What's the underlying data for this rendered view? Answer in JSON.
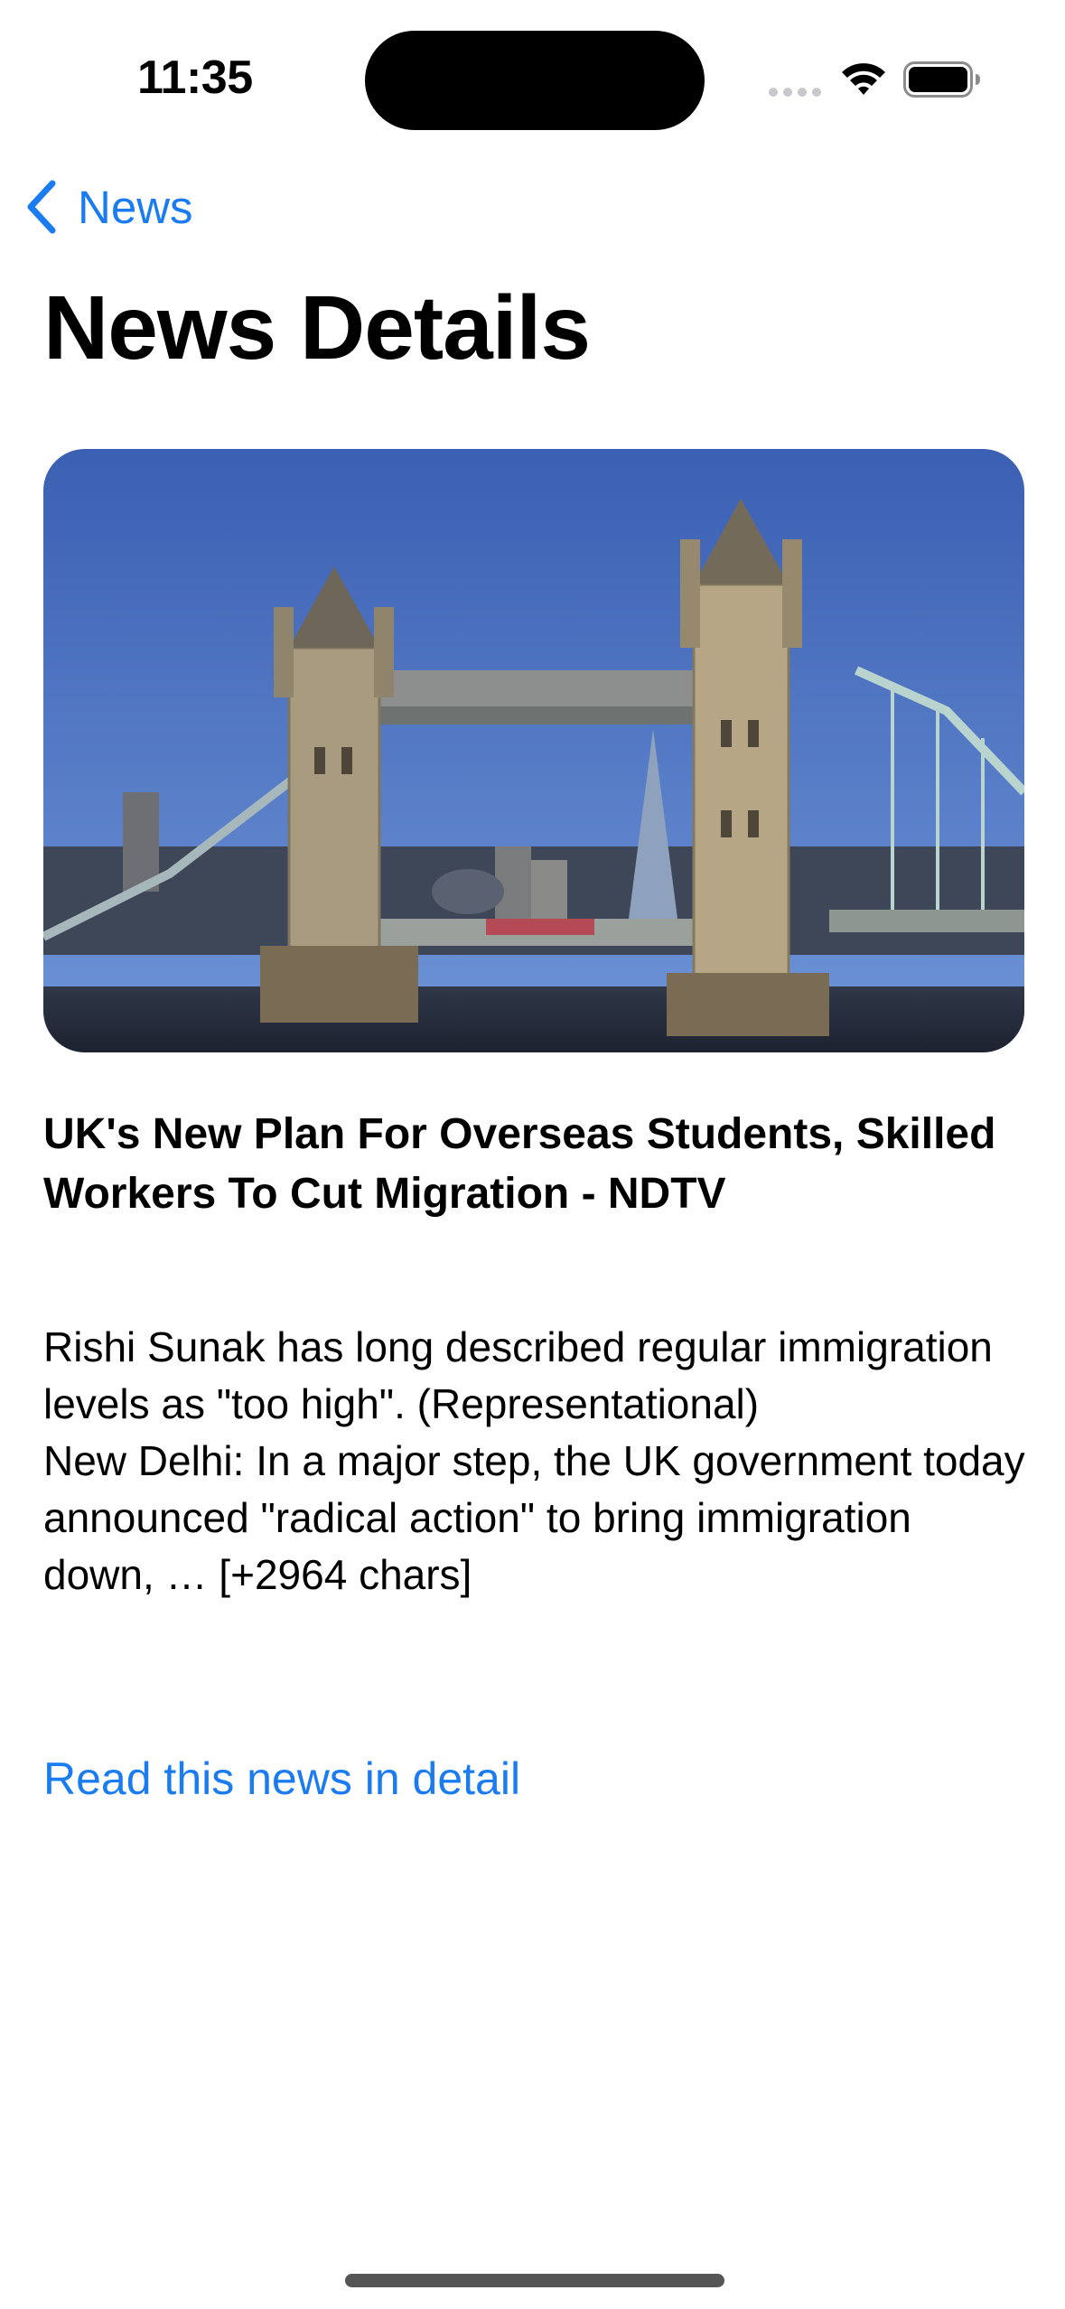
{
  "status_bar": {
    "time": "11:35"
  },
  "nav": {
    "back_label": "News",
    "title": "News Details"
  },
  "article": {
    "image_icon": "tower-bridge-photo",
    "headline": "UK's New Plan For Overseas Students, Skilled Workers To Cut Migration - NDTV",
    "description": "Rishi Sunak has long described regular immigration levels as \"too high\". (Representational)\nNew Delhi: In a major step, the UK government today announced \"radical action\" to bring immigration down, … [+2964 chars]",
    "read_more_label": "Read this news in detail"
  },
  "colors": {
    "accent": "#1a7cf0",
    "text": "#000000",
    "background": "#ffffff"
  }
}
